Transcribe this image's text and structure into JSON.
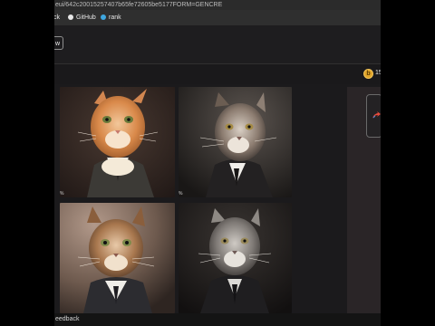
{
  "browser": {
    "address_text": "eui/642c20015257407b65fe72605be5177FORM=GENCRE",
    "bookmarks": [
      {
        "label": "ck",
        "dot_color": ""
      },
      {
        "label": "GitHub",
        "dot_color": ""
      },
      {
        "label": "rank",
        "dot_color": "#3fa7e0"
      }
    ]
  },
  "header": {
    "partial_button_label": "w"
  },
  "toolbar": {
    "coin_symbol": "b",
    "coin_count": "15"
  },
  "gallery": {
    "images": [
      {
        "subject": "orange tabby cat in dark suit",
        "corner_mark": "%"
      },
      {
        "subject": "grey tabby cat in black suit",
        "corner_mark": "%"
      },
      {
        "subject": "brown tabby cat in dark suit",
        "corner_mark": ""
      },
      {
        "subject": "grey cat in black suit and tie",
        "corner_mark": ""
      }
    ]
  },
  "side_panel": {
    "icon": "share-arrow-icon"
  },
  "footer": {
    "text": "eedback"
  },
  "colors": {
    "page_bg": "#1b1a1c",
    "coin": "#e0a52b",
    "accent_arrow": "#e84a3c"
  }
}
